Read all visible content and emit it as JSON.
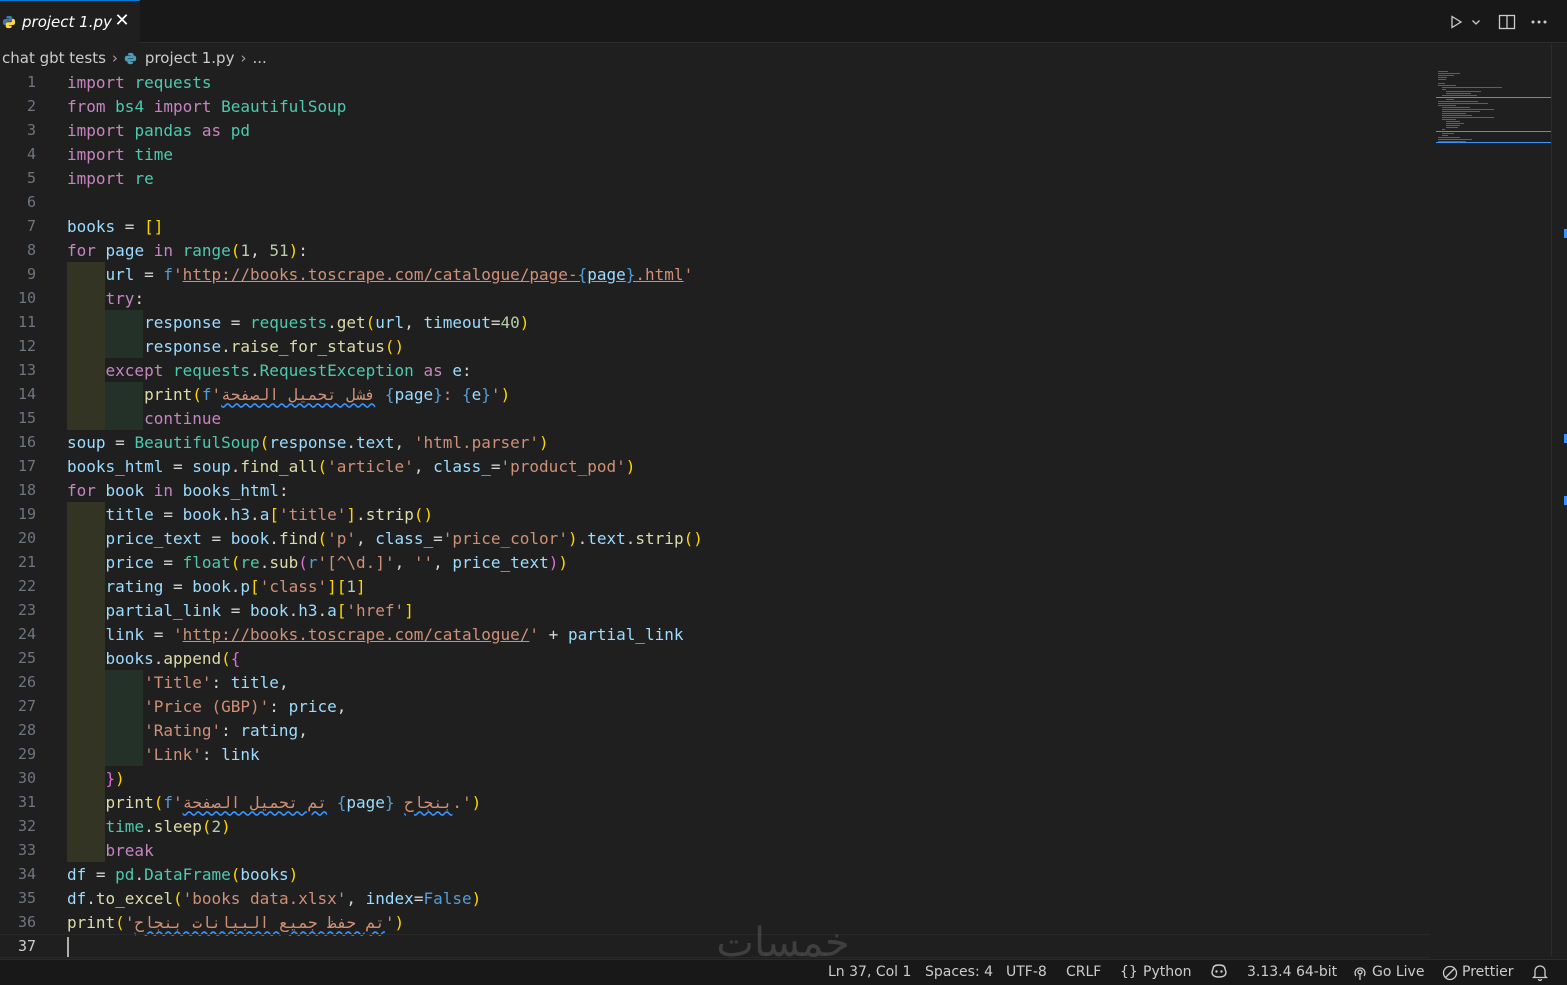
{
  "tab": {
    "label": "project 1.py",
    "close": "✕"
  },
  "breadcrumb": {
    "folder": "chat gbt tests",
    "file": "project 1.py",
    "more": "..."
  },
  "editor": {
    "current_line": 37,
    "lines": [
      {
        "n": "1"
      },
      {
        "n": "2"
      },
      {
        "n": "3"
      },
      {
        "n": "4"
      },
      {
        "n": "5"
      },
      {
        "n": "6"
      },
      {
        "n": "7"
      },
      {
        "n": "8"
      },
      {
        "n": "9"
      },
      {
        "n": "10"
      },
      {
        "n": "11"
      },
      {
        "n": "12"
      },
      {
        "n": "13"
      },
      {
        "n": "14"
      },
      {
        "n": "15"
      },
      {
        "n": "16"
      },
      {
        "n": "17"
      },
      {
        "n": "18"
      },
      {
        "n": "19"
      },
      {
        "n": "20"
      },
      {
        "n": "21"
      },
      {
        "n": "22"
      },
      {
        "n": "23"
      },
      {
        "n": "24"
      },
      {
        "n": "25"
      },
      {
        "n": "26"
      },
      {
        "n": "27"
      },
      {
        "n": "28"
      },
      {
        "n": "29"
      },
      {
        "n": "30"
      },
      {
        "n": "31"
      },
      {
        "n": "32"
      },
      {
        "n": "33"
      },
      {
        "n": "34"
      },
      {
        "n": "35"
      },
      {
        "n": "36"
      },
      {
        "n": "37"
      }
    ]
  },
  "statusbar": {
    "position": "Ln 37, Col 1",
    "indent": "Spaces: 4",
    "encoding": "UTF-8",
    "eol": "CRLF",
    "language_icon": "{}",
    "language": "Python",
    "interpreter": "3.13.4 64-bit",
    "golive": "Go Live",
    "prettier": "Prettier"
  },
  "watermark": {
    "text": "خمسات"
  },
  "colors": {
    "accent": "#0078d4",
    "keyword": "#c586c0",
    "string": "#ce9178",
    "variable": "#9cdcfe",
    "function": "#dcdcaa",
    "class": "#4ec9b0"
  },
  "icons": [
    "python-file-icon",
    "close-icon",
    "run-icon",
    "split-editor-icon",
    "more-actions-icon",
    "copilot-icon",
    "broadcast-icon",
    "prettier-icon",
    "bell-icon"
  ]
}
